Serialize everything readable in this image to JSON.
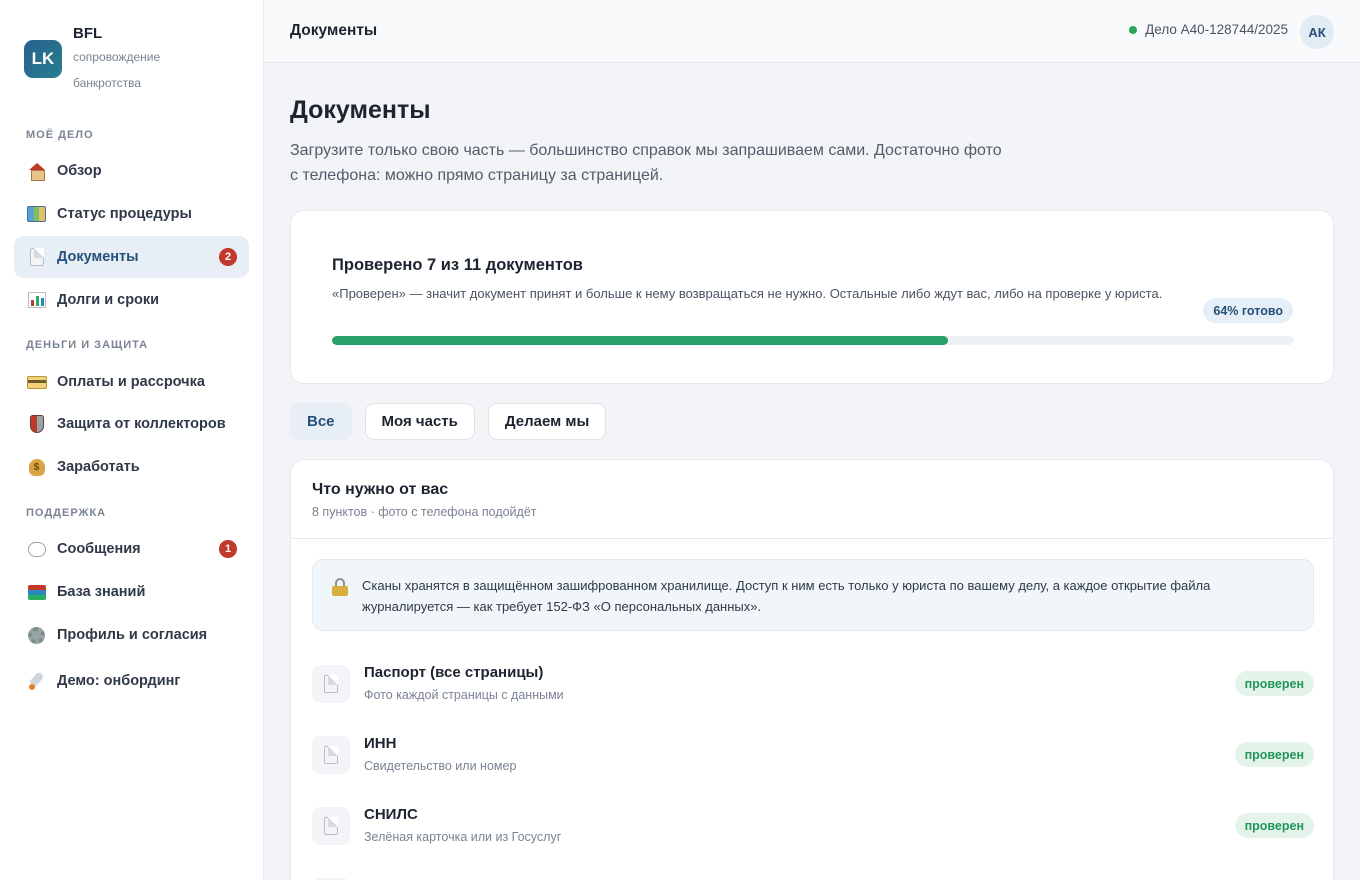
{
  "brand": {
    "logo": "LK",
    "name": "BFL",
    "subtitle": "сопровождение банкротства"
  },
  "sidebar": {
    "sections": [
      "МОЁ ДЕЛО",
      "ДЕНЬГИ И ЗАЩИТА",
      "ПОДДЕРЖКА"
    ],
    "items": [
      {
        "label": "Обзор",
        "icon": "house-icon"
      },
      {
        "label": "Статус процедуры",
        "icon": "map-icon"
      },
      {
        "label": "Документы",
        "icon": "document-icon",
        "badge": "2",
        "active": true
      },
      {
        "label": "Долги и сроки",
        "icon": "bar-chart-icon"
      },
      {
        "label": "Оплаты и рассрочка",
        "icon": "credit-card-icon"
      },
      {
        "label": "Защита от коллекторов",
        "icon": "shield-icon"
      },
      {
        "label": "Заработать",
        "icon": "money-bag-icon"
      },
      {
        "label": "Сообщения",
        "icon": "speech-bubble-icon",
        "badge": "1"
      },
      {
        "label": "База знаний",
        "icon": "books-icon"
      },
      {
        "label": "Профиль и согласия",
        "icon": "gear-icon"
      },
      {
        "label": "Демо: онбординг",
        "icon": "rocket-icon"
      }
    ]
  },
  "topbar": {
    "title": "Документы",
    "case_label": "Дело А40-128744/2025",
    "avatar": "АК"
  },
  "main": {
    "title": "Документы",
    "subtitle": "Загрузите только свою часть — большинство справок мы запрашиваем сами. Достаточно фото с телефона: можно прямо страницу за страницей."
  },
  "progress": {
    "title": "Проверено 7 из 11 документов",
    "description": "«Проверен» — значит документ принят и больше к нему возвращаться не нужно. Остальные либо ждут вас, либо на проверке у юриста.",
    "pill": "64% готово",
    "fraction": 0.64,
    "fill_color": "#27a06a"
  },
  "filters": [
    "Все",
    "Моя часть",
    "Делаем мы"
  ],
  "docs": {
    "title": "Что нужно от вас",
    "subtitle": "8 пунктов · фото с телефона подойдёт",
    "notice": "Сканы хранятся в защищённом зашифрованном хранилище. Доступ к ним есть только у юриста по вашему делу, а каждое открытие файла журналируется — как требует 152-ФЗ «О персональных данных».",
    "items": [
      {
        "name": "Паспорт (все страницы)",
        "desc": "Фото каждой страницы с данными",
        "status": "проверен"
      },
      {
        "name": "ИНН",
        "desc": "Свидетельство или номер",
        "status": "проверен"
      },
      {
        "name": "СНИЛС",
        "desc": "Зелёная карточка или из Госуслуг",
        "status": "проверен"
      }
    ]
  },
  "colors": {
    "accent": "#25507a",
    "success": "#23965a",
    "badge": "#c0392b"
  }
}
